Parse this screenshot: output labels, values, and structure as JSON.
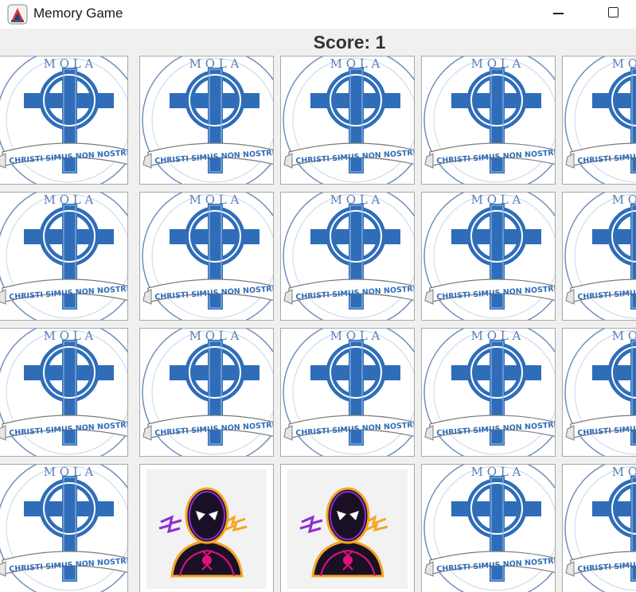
{
  "window": {
    "title": "Memory Game",
    "icon": "java-cup-icon",
    "controls": [
      "minimize-icon",
      "maximize-icon"
    ]
  },
  "score": {
    "label": "Score: 1",
    "value": 1
  },
  "card_back": {
    "motto": "CHRISTI SIMUS NON NOSTRI",
    "icon": "celtic-cross-icon",
    "colors": {
      "cross": "#2f6db8",
      "ring": "#5b8fd0",
      "border": "#a9a9a9"
    }
  },
  "board": {
    "rows": 4,
    "columns": 5,
    "cards": [
      [
        "back",
        "back",
        "back",
        "back",
        "back"
      ],
      [
        "back",
        "back",
        "back",
        "back",
        "back"
      ],
      [
        "back",
        "back",
        "back",
        "back",
        "back"
      ],
      [
        "back",
        "spider-hero",
        "spider-hero",
        "back",
        "back"
      ]
    ]
  },
  "revealed_card": {
    "icon": "spider-hero-icon",
    "colors": {
      "body": "#1a1026",
      "accent": "#e0127a",
      "glow": "#f5a623",
      "lines": "#8e2bd6"
    }
  }
}
